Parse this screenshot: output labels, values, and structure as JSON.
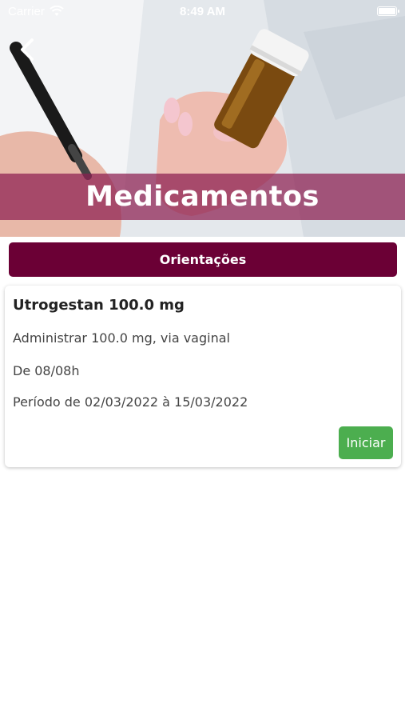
{
  "status_bar": {
    "carrier": "Carrier",
    "time": "8:49 AM"
  },
  "header": {
    "title": "Medicamentos"
  },
  "orientations_button": {
    "label": "Orientações"
  },
  "medication_card": {
    "name": "Utrogestan 100.0 mg",
    "administration": "Administrar 100.0 mg, via vaginal",
    "schedule": "De 08/08h",
    "period": "Período de 02/03/2022  à 15/03/2022",
    "start_label": "Iniciar"
  },
  "colors": {
    "primary": "#6b0035",
    "title_band": "#8c1e50",
    "start_button": "#4cae4f"
  },
  "icons": {
    "back": "chevron-left-icon",
    "wifi": "wifi-icon",
    "battery": "battery-icon"
  }
}
